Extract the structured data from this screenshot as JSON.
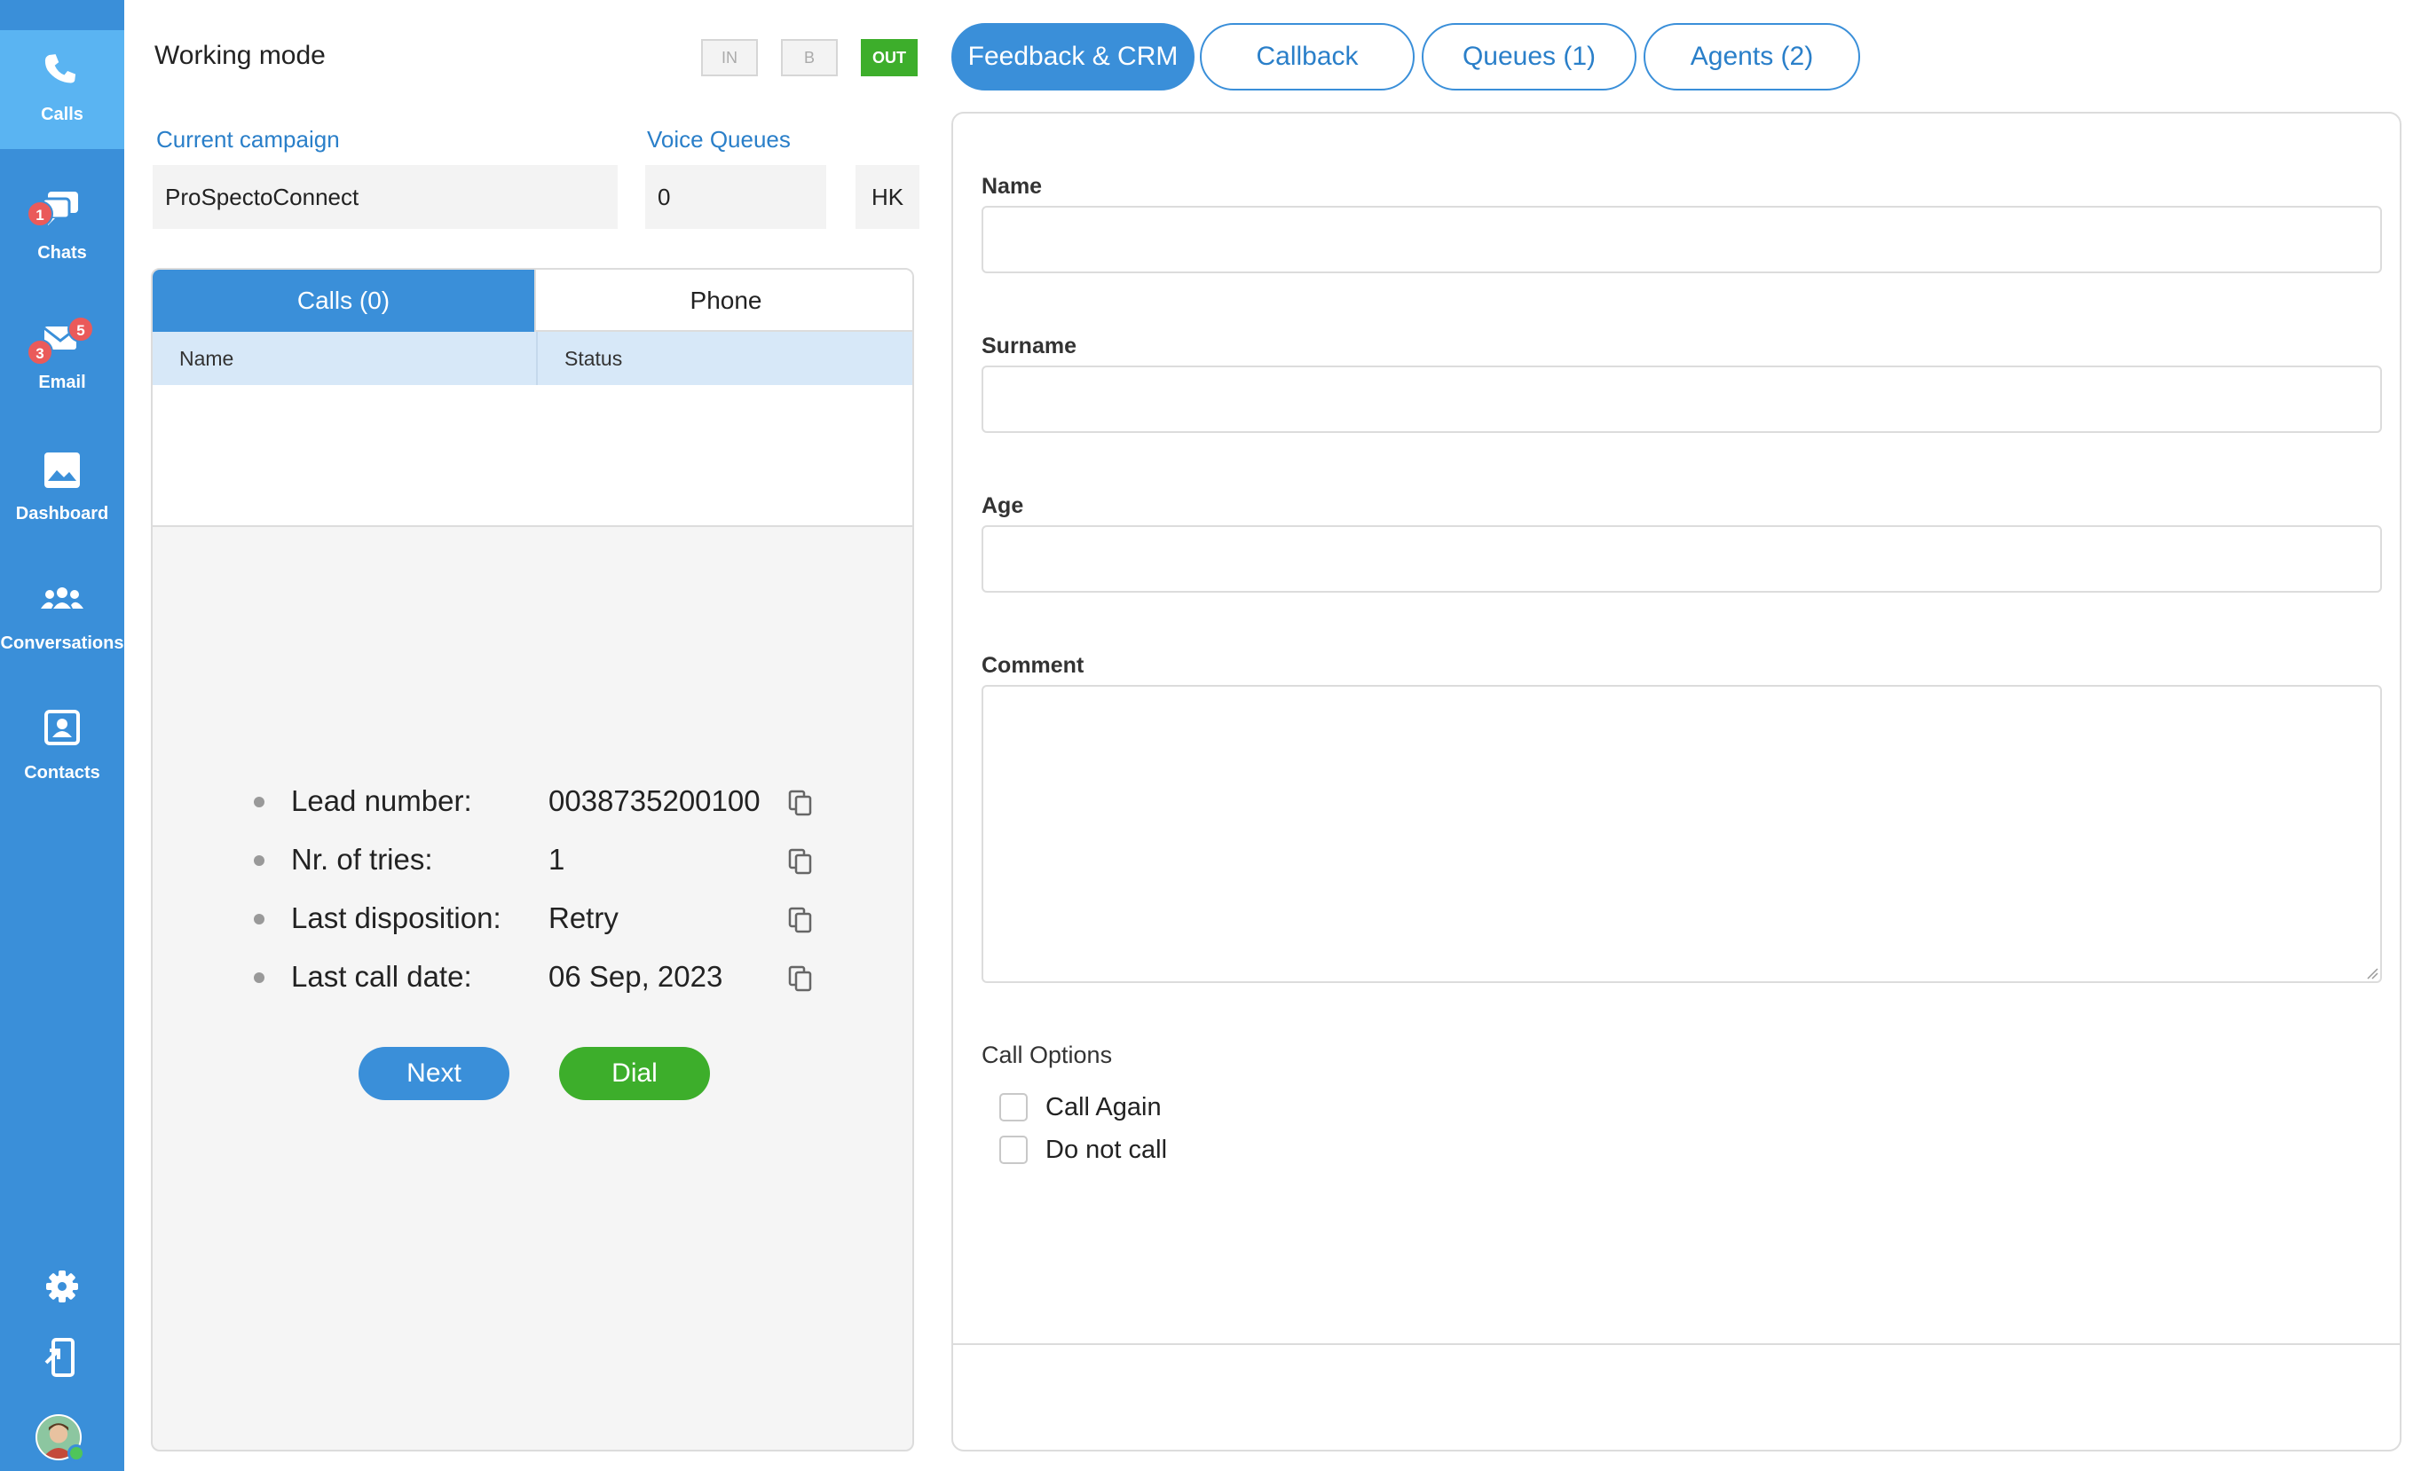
{
  "sidebar": {
    "items": [
      {
        "label": "Calls",
        "icon": "phone-icon"
      },
      {
        "label": "Chats",
        "icon": "chat-icon",
        "badge": "1"
      },
      {
        "label": "Email",
        "icon": "email-icon",
        "badge_left": "3",
        "badge_right": "5"
      },
      {
        "label": "Dashboard",
        "icon": "dashboard-icon"
      },
      {
        "label": "Conversations",
        "icon": "people-icon"
      },
      {
        "label": "Contacts",
        "icon": "contact-card-icon"
      }
    ],
    "bottom_icons": [
      "gear-icon",
      "logout-icon",
      "avatar"
    ]
  },
  "header": {
    "working_mode": "Working mode",
    "modes": {
      "in": "IN",
      "b": "B",
      "out": "OUT"
    },
    "active_mode": "OUT"
  },
  "campaign": {
    "current_label": "Current campaign",
    "current_value": "ProSpectoConnect",
    "queues_label": "Voice Queues",
    "queues_value": "0",
    "code": "HK"
  },
  "calls_panel": {
    "tab_calls": "Calls (0)",
    "tab_phone": "Phone",
    "columns": [
      "Name",
      "Status"
    ],
    "lead": [
      {
        "key": "Lead number:",
        "value": "0038735200100"
      },
      {
        "key": "Nr. of tries:",
        "value": "1"
      },
      {
        "key": "Last disposition:",
        "value": "Retry"
      },
      {
        "key": "Last call date:",
        "value": "06 Sep, 2023"
      }
    ],
    "next_label": "Next",
    "dial_label": "Dial"
  },
  "right_tabs": [
    "Feedback & CRM",
    "Callback",
    "Queues (1)",
    "Agents (2)"
  ],
  "form": {
    "name_label": "Name",
    "surname_label": "Surname",
    "age_label": "Age",
    "comment_label": "Comment",
    "options_title": "Call Options",
    "options": [
      "Call Again",
      "Do not call"
    ]
  },
  "colors": {
    "sidebar": "#3a8fd9",
    "sidebar_active": "#5ab4f2",
    "accent": "#3a8fd9",
    "dial_green": "#3dae2b",
    "badge_red": "#ea5a5a"
  }
}
